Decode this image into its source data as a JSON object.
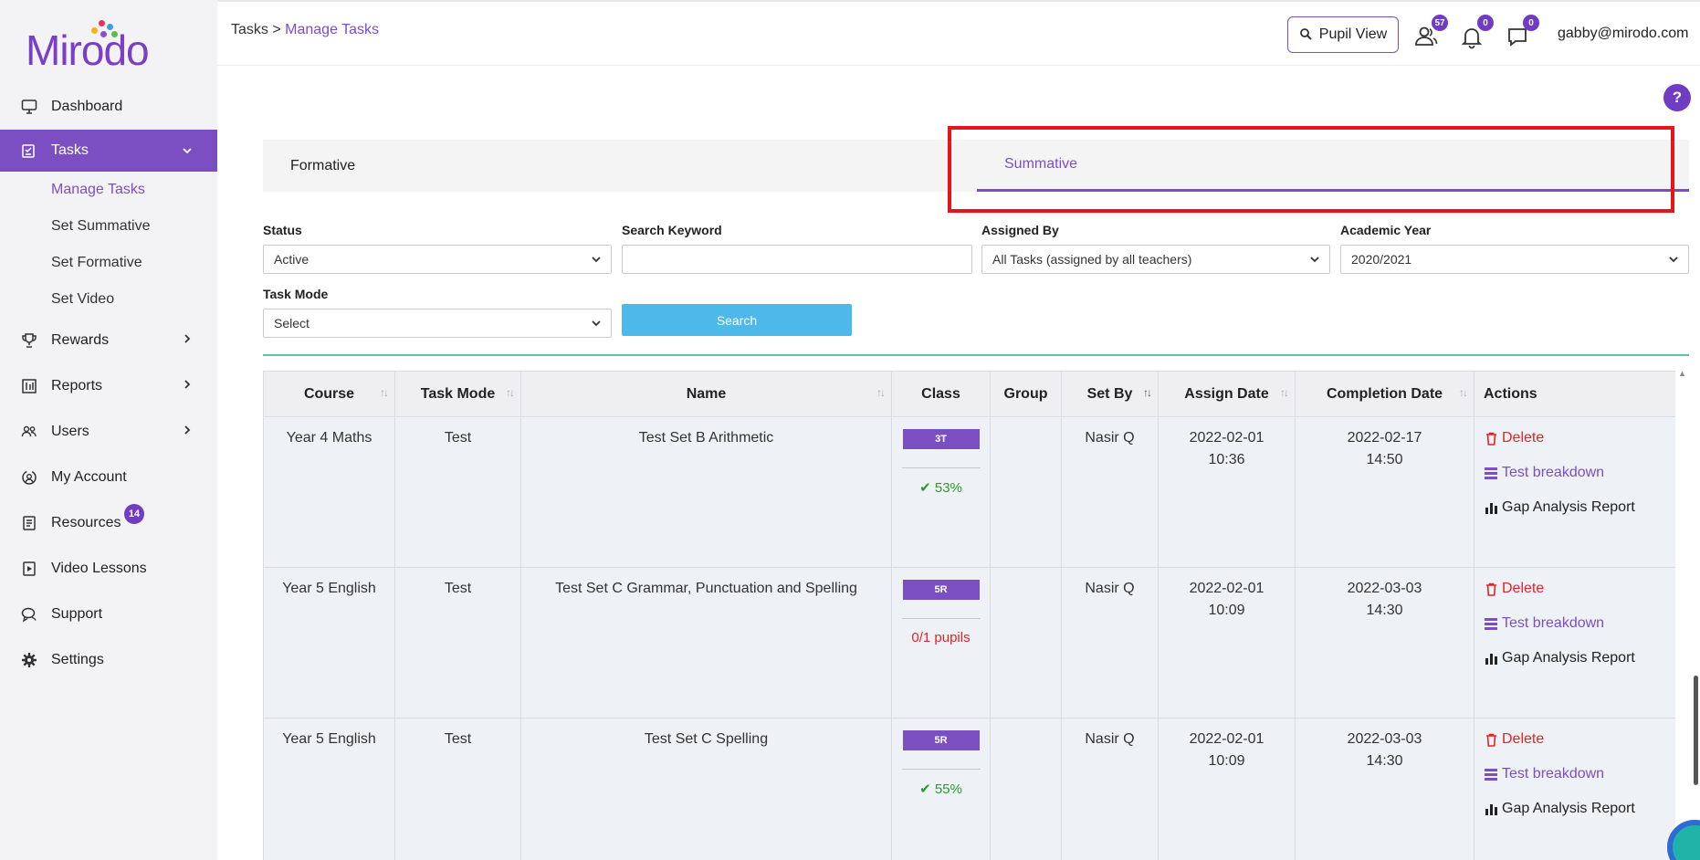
{
  "brand": {
    "name": "Mirodo"
  },
  "sidebar": {
    "items": [
      {
        "label": "Dashboard",
        "icon": "monitor-icon"
      },
      {
        "label": "Tasks",
        "icon": "tasks-icon"
      },
      {
        "label": "Rewards",
        "icon": "trophy-icon"
      },
      {
        "label": "Reports",
        "icon": "reports-icon"
      },
      {
        "label": "Users",
        "icon": "users-icon"
      },
      {
        "label": "My Account",
        "icon": "account-icon"
      },
      {
        "label": "Resources",
        "icon": "resources-icon",
        "badge": "14"
      },
      {
        "label": "Video Lessons",
        "icon": "video-icon"
      },
      {
        "label": "Support",
        "icon": "support-icon"
      },
      {
        "label": "Settings",
        "icon": "gear-icon"
      }
    ],
    "tasks_sub": [
      "Manage Tasks",
      "Set Summative",
      "Set Formative",
      "Set Video"
    ]
  },
  "header": {
    "breadcrumb_root": "Tasks",
    "breadcrumb_sep": ">",
    "breadcrumb_current": "Manage Tasks",
    "pupil_view": "Pupil View",
    "users_badge": "57",
    "notifications_badge": "0",
    "messages_badge": "0",
    "user_email": "gabby@mirodo.com"
  },
  "help": "?",
  "tabs": {
    "formative": "Formative",
    "summative": "Summative"
  },
  "filters": {
    "status_label": "Status",
    "status_value": "Active",
    "keyword_label": "Search Keyword",
    "keyword_value": "",
    "assigned_label": "Assigned By",
    "assigned_value": "All Tasks (assigned by all teachers)",
    "year_label": "Academic Year",
    "year_value": "2020/2021",
    "mode_label": "Task Mode",
    "mode_value": "Select",
    "search_label": "Search"
  },
  "table": {
    "headers": [
      "Course",
      "Task Mode",
      "Name",
      "Class",
      "Group",
      "Set By",
      "Assign Date",
      "Completion Date",
      "Actions"
    ],
    "rows": [
      {
        "course": "Year 4 Maths",
        "mode": "Test",
        "name": "Test Set B Arithmetic",
        "class": "3T",
        "stat": "53%",
        "stat_ok": true,
        "group": "",
        "set_by": "Nasir Q",
        "assign_date": "2022-02-01",
        "assign_time": "10:36",
        "completion_date": "2022-02-17",
        "completion_time": "14:50"
      },
      {
        "course": "Year 5 English",
        "mode": "Test",
        "name": "Test Set C Grammar, Punctuation and Spelling",
        "class": "5R",
        "stat": "0/1 pupils",
        "stat_ok": false,
        "group": "",
        "set_by": "Nasir Q",
        "assign_date": "2022-02-01",
        "assign_time": "10:09",
        "completion_date": "2022-03-03",
        "completion_time": "14:30"
      },
      {
        "course": "Year 5 English",
        "mode": "Test",
        "name": "Test Set C Spelling",
        "class": "5R",
        "stat": "55%",
        "stat_ok": true,
        "group": "",
        "set_by": "Nasir Q",
        "assign_date": "2022-02-01",
        "assign_time": "10:09",
        "completion_date": "2022-03-03",
        "completion_time": "14:30"
      }
    ],
    "actions": {
      "delete": "Delete",
      "breakdown": "Test breakdown",
      "gap": "Gap Analysis Report"
    }
  },
  "colors": {
    "accent": "#7b4fc2",
    "search": "#4db8ea",
    "danger": "#e32424",
    "highlight": "#e8141b"
  }
}
